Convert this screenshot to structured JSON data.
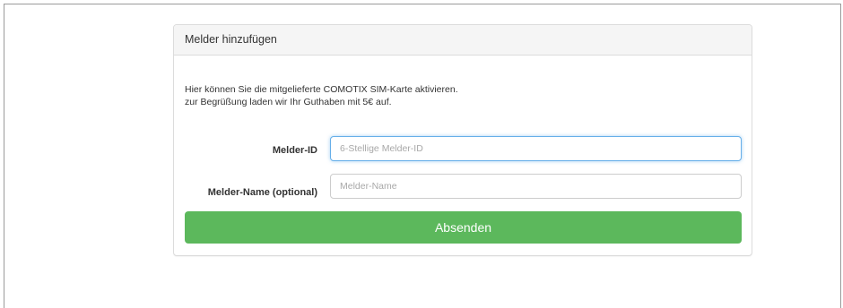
{
  "panel": {
    "title": "Melder hinzufügen"
  },
  "intro": {
    "line1": "Hier können Sie die mitgelieferte COMOTIX SIM-Karte aktivieren.",
    "line2": "zur Begrüßung laden wir Ihr Guthaben mit 5€ auf."
  },
  "form": {
    "melder_id": {
      "label": "Melder-ID",
      "value": "",
      "placeholder": "6-Stellige Melder-ID"
    },
    "melder_name": {
      "label": "Melder-Name (optional)",
      "value": "",
      "placeholder": "Melder-Name"
    },
    "submit_label": "Absenden"
  },
  "colors": {
    "submit_bg": "#5cb85c",
    "focus_border": "#66afe9",
    "heading_bg": "#f5f5f5"
  }
}
